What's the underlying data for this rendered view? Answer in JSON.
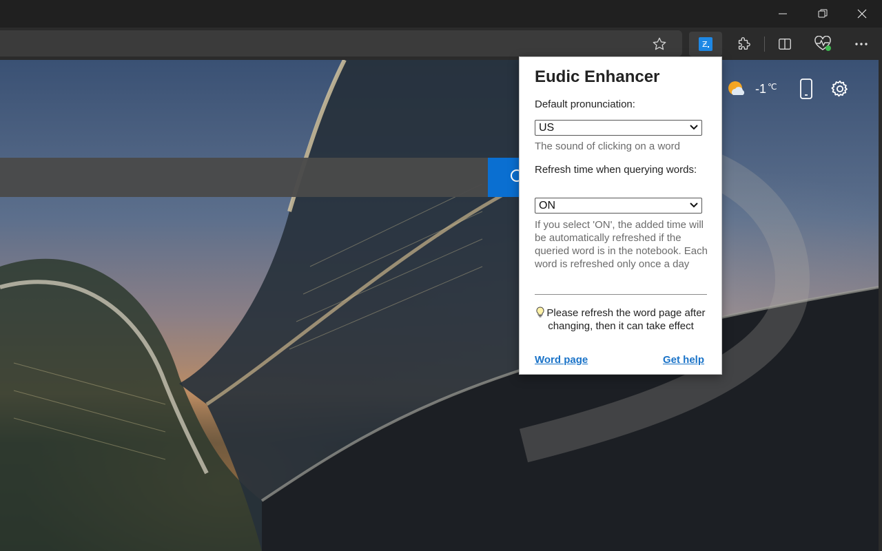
{
  "browser": {
    "icons": {
      "minimize": "minimize-icon",
      "restore": "restore-icon",
      "close": "close-icon",
      "favorite": "star-icon",
      "eudic_extension": "eudic-extension-icon",
      "extensions": "puzzle-icon",
      "split_screen": "split-screen-icon",
      "browser_essentials": "heart-pulse-icon",
      "more": "more-icon"
    },
    "accent_color": "#0a6fd1"
  },
  "newtab": {
    "weather": {
      "temperature": "-1",
      "unit": "℃",
      "icon": "partly-cloudy-icon"
    },
    "icons": {
      "phone": "phone-icon",
      "settings": "gear-icon",
      "search": "search-icon"
    }
  },
  "popup": {
    "title": "Eudic Enhancer",
    "pronunciation_label": "Default pronunciation:",
    "pronunciation_value": "US",
    "pronunciation_hint": "The sound of clicking on a word",
    "refresh_label": "Refresh time when querying words:",
    "refresh_value": "ON",
    "refresh_hint": "If you select 'ON', the added time will be automatically refreshed if the queried word is in the notebook. Each word is refreshed only once a day",
    "note": "Please refresh the word page after changing, then it can take effect",
    "note_icon": "lightbulb-icon",
    "link_word_page": "Word page",
    "link_get_help": "Get help",
    "link_color": "#1a73c8"
  }
}
